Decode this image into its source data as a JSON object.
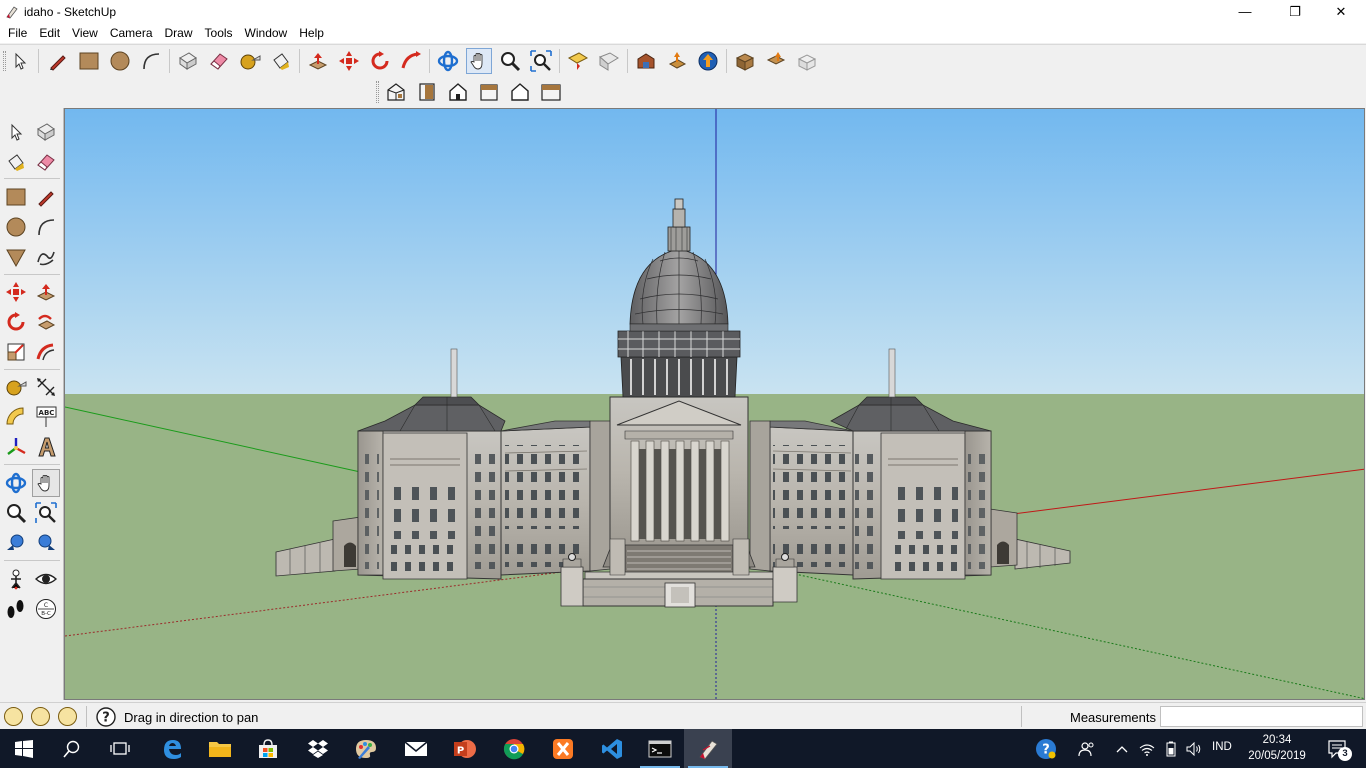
{
  "window": {
    "title": "idaho - SketchUp",
    "minimize_glyph": "—",
    "restore_glyph": "❐",
    "close_glyph": "✕"
  },
  "menu": [
    "File",
    "Edit",
    "View",
    "Camera",
    "Draw",
    "Tools",
    "Window",
    "Help"
  ],
  "toolbar_main": [
    {
      "name": "select-icon"
    },
    {
      "name": "pencil-icon"
    },
    {
      "name": "rectangle-icon"
    },
    {
      "name": "circle-icon"
    },
    {
      "name": "arc-icon"
    },
    {
      "name": "make-component-icon"
    },
    {
      "name": "eraser-icon"
    },
    {
      "name": "tape-measure-icon"
    },
    {
      "name": "paint-bucket-icon"
    },
    {
      "name": "push-pull-icon"
    },
    {
      "name": "move-icon"
    },
    {
      "name": "rotate-icon"
    },
    {
      "name": "follow-me-icon"
    },
    {
      "name": "orbit-icon"
    },
    {
      "name": "pan-icon"
    },
    {
      "name": "zoom-icon"
    },
    {
      "name": "zoom-extents-icon"
    },
    {
      "name": "add-location-icon"
    },
    {
      "name": "toggle-terrain-icon"
    },
    {
      "name": "3d-warehouse-icon"
    },
    {
      "name": "share-component-icon"
    },
    {
      "name": "upload-icon"
    },
    {
      "name": "extension-warehouse-icon"
    },
    {
      "name": "send-to-layout-icon"
    },
    {
      "name": "ext-manager-icon"
    }
  ],
  "toolbar_views": [
    {
      "name": "iso-view-icon"
    },
    {
      "name": "top-view-icon"
    },
    {
      "name": "front-view-icon"
    },
    {
      "name": "right-view-icon"
    },
    {
      "name": "back-view-icon"
    },
    {
      "name": "left-view-icon"
    }
  ],
  "palette": [
    {
      "name": "select-tool-icon"
    },
    {
      "name": "make-component-tool-icon"
    },
    {
      "name": "paint-bucket-tool-icon"
    },
    {
      "name": "eraser-tool-icon"
    },
    {
      "name": "rectangle-tool-icon"
    },
    {
      "name": "line-tool-icon"
    },
    {
      "name": "circle-tool-icon"
    },
    {
      "name": "arc-tool-icon"
    },
    {
      "name": "polygon-tool-icon"
    },
    {
      "name": "freehand-tool-icon"
    },
    {
      "name": "move-tool-icon"
    },
    {
      "name": "push-pull-tool-icon"
    },
    {
      "name": "rotate-tool-icon"
    },
    {
      "name": "follow-me-tool-icon"
    },
    {
      "name": "scale-tool-icon"
    },
    {
      "name": "offset-tool-icon"
    },
    {
      "name": "tape-measure-tool-icon"
    },
    {
      "name": "dimension-tool-icon"
    },
    {
      "name": "protractor-tool-icon"
    },
    {
      "name": "text-tool-icon"
    },
    {
      "name": "axes-tool-icon"
    },
    {
      "name": "3d-text-tool-icon"
    },
    {
      "name": "orbit-tool-icon"
    },
    {
      "name": "pan-tool-icon"
    },
    {
      "name": "zoom-tool-icon"
    },
    {
      "name": "zoom-window-tool-icon"
    },
    {
      "name": "previous-view-icon"
    },
    {
      "name": "next-view-icon"
    },
    {
      "name": "position-camera-tool-icon"
    },
    {
      "name": "look-around-tool-icon"
    },
    {
      "name": "walk-tool-icon"
    },
    {
      "name": "section-plane-tool-icon"
    }
  ],
  "palette_labels": {
    "text_tool": "ABC",
    "section_tool": "C\nB-C"
  },
  "status": {
    "hint": "Drag in direction to pan",
    "measurements_label": "Measurements",
    "measurements_value": ""
  },
  "taskbar": {
    "apps": [
      {
        "name": "start-button",
        "running": false
      },
      {
        "name": "search-button",
        "running": false
      },
      {
        "name": "task-view-button",
        "running": false
      },
      {
        "name": "edge-app",
        "running": false
      },
      {
        "name": "file-explorer-app",
        "running": false
      },
      {
        "name": "store-app",
        "running": false
      },
      {
        "name": "dropbox-app",
        "running": false
      },
      {
        "name": "paint-app",
        "running": false
      },
      {
        "name": "mail-app",
        "running": false
      },
      {
        "name": "powerpoint-app",
        "running": false
      },
      {
        "name": "chrome-app",
        "running": false
      },
      {
        "name": "xampp-app",
        "running": false
      },
      {
        "name": "vscode-app",
        "running": false
      },
      {
        "name": "terminal-app",
        "running": true
      },
      {
        "name": "sketchup-app",
        "running": true
      }
    ],
    "language": "IND",
    "time": "20:34",
    "date": "20/05/2019",
    "notification_count": "3"
  },
  "colors": {
    "sky_top": "#74b9ee",
    "sky_bottom": "#c9e2f1",
    "ground": "#98b486",
    "axis_blue": "#1f1f9c",
    "axis_green": "#1a9b1a",
    "axis_red": "#c01818",
    "taskbar": "#101828"
  }
}
